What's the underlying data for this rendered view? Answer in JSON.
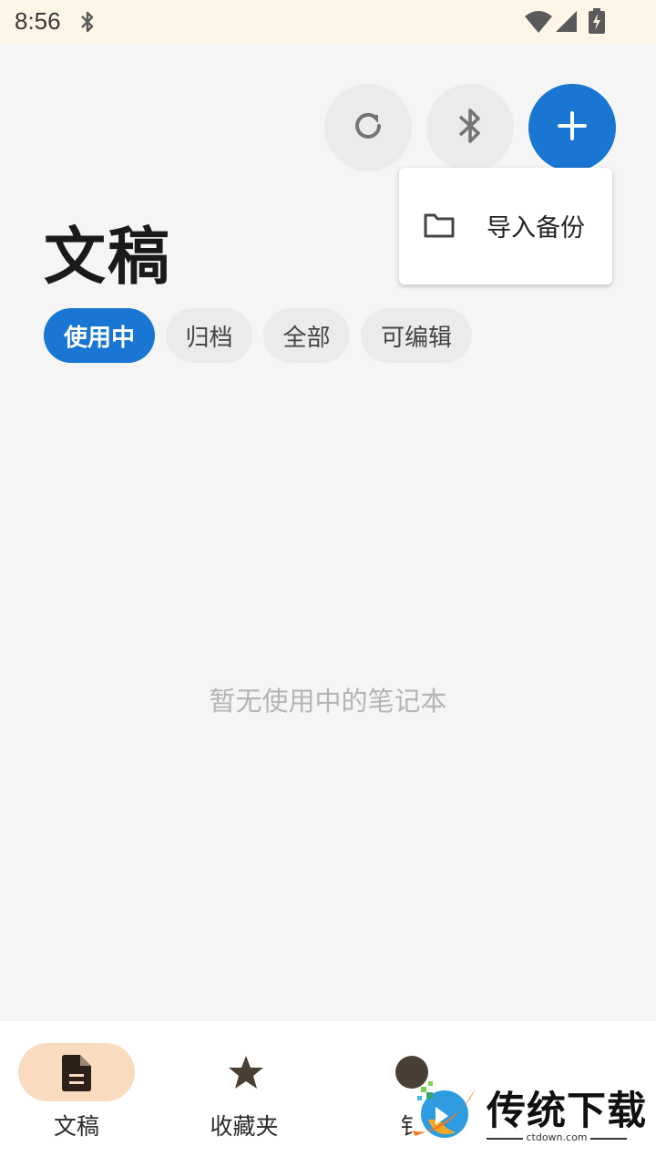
{
  "status_bar": {
    "time": "8:56"
  },
  "toolbar": {
    "refresh_icon": "refresh-icon",
    "bluetooth_icon": "bluetooth-icon",
    "add_icon": "plus-icon"
  },
  "menu": {
    "items": [
      {
        "icon": "folder-icon",
        "label": "导入备份"
      }
    ]
  },
  "page": {
    "title": "文稿"
  },
  "filters": {
    "chips": [
      {
        "label": "使用中",
        "active": true
      },
      {
        "label": "归档",
        "active": false
      },
      {
        "label": "全部",
        "active": false
      },
      {
        "label": "可编辑",
        "active": false
      }
    ]
  },
  "empty_state": {
    "text": "暂无使用中的笔记本"
  },
  "bottom_nav": {
    "items": [
      {
        "icon": "document-icon",
        "label": "文稿",
        "active": true
      },
      {
        "icon": "star-icon",
        "label": "收藏夹",
        "active": false
      },
      {
        "icon": "circle-icon",
        "label": "钅",
        "active": false
      }
    ]
  },
  "watermark": {
    "title": "传统下载",
    "subtitle": "ctdown.com"
  },
  "colors": {
    "accent": "#1976d2",
    "status_bar_bg": "#fdf6e6",
    "nav_active_pill": "#f9dcc0",
    "background": "#f5f5f5"
  }
}
